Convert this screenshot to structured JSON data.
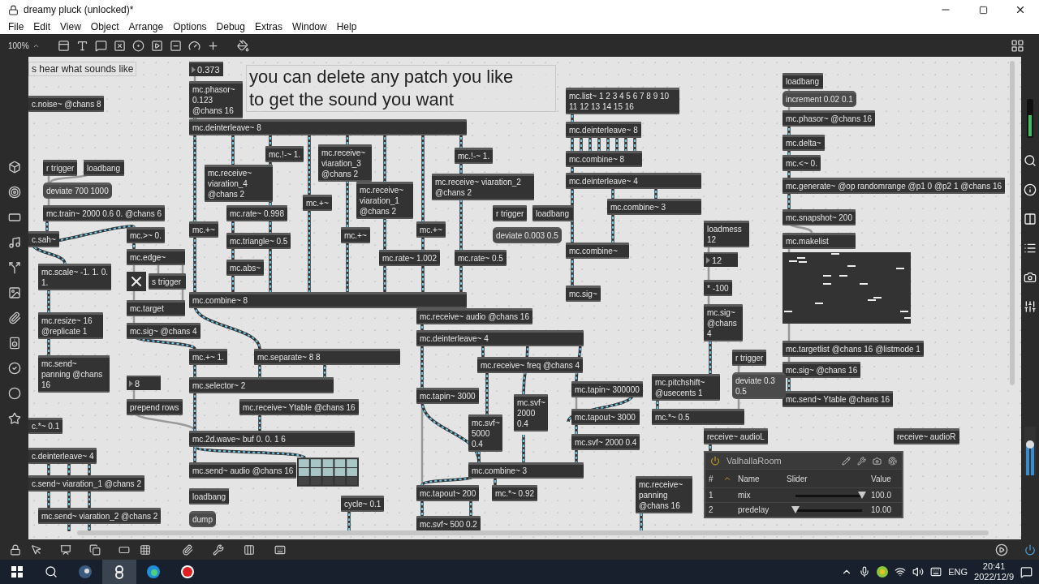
{
  "window": {
    "title": "dreamy pluck (unlocked)*"
  },
  "menu": [
    "File",
    "Edit",
    "View",
    "Object",
    "Arrange",
    "Options",
    "Debug",
    "Extras",
    "Window",
    "Help"
  ],
  "toolbar": {
    "zoom": "100%"
  },
  "patch": {
    "nodes": [
      {
        "kind": "comment",
        "text": "s hear what sounds like"
      },
      {
        "kind": "number",
        "text": "0.373"
      },
      {
        "kind": "object",
        "text": "mc.phasor~ 0.123 @chans 16"
      },
      {
        "kind": "object",
        "text": "c.noise~ @chans 8"
      },
      {
        "kind": "heading",
        "text": "you can delete any patch you like to get  the sound you want"
      },
      {
        "kind": "object",
        "text": "mc.deinterleave~ 8"
      },
      {
        "kind": "object",
        "text": "mc.!-~ 1."
      },
      {
        "kind": "object",
        "text": "mc.receive~ viaration_3 @chans 2"
      },
      {
        "kind": "object",
        "text": "mc.!-~ 1."
      },
      {
        "kind": "object",
        "text": "mc.list~ 1 2 3 4 5 6 7 8 9 10 11 12 13 14 15 16"
      },
      {
        "kind": "object",
        "text": "mc.deinterleave~ 8"
      },
      {
        "kind": "object",
        "text": "mc.combine~ 8"
      },
      {
        "kind": "object",
        "text": "mc.deinterleave~ 4"
      },
      {
        "kind": "object",
        "text": "mc.combine~ 3"
      },
      {
        "kind": "object",
        "text": "mc.combine~"
      },
      {
        "kind": "object",
        "text": "mc.sig~"
      },
      {
        "kind": "object",
        "text": "r trigger"
      },
      {
        "kind": "object",
        "text": "loadbang"
      },
      {
        "kind": "message",
        "text": "deviate 700 1000"
      },
      {
        "kind": "object",
        "text": "mc.receive~ viaration_4 @chans 2"
      },
      {
        "kind": "object",
        "text": "mc.+~"
      },
      {
        "kind": "object",
        "text": "mc.receive~ viaration_1 @chans 2"
      },
      {
        "kind": "object",
        "text": "mc.receive~ viaration_2 @chans 2"
      },
      {
        "kind": "object",
        "text": "mc.train~ 2000 0.6 0. @chans 6"
      },
      {
        "kind": "object",
        "text": "mc.rate~ 0.998"
      },
      {
        "kind": "object",
        "text": "mc.+~"
      },
      {
        "kind": "object",
        "text": "mc.+~"
      },
      {
        "kind": "object",
        "text": "mc.+~"
      },
      {
        "kind": "object",
        "text": "r trigger"
      },
      {
        "kind": "object",
        "text": "loadbang"
      },
      {
        "kind": "message",
        "text": "deviate 0.003 0.5"
      },
      {
        "kind": "object",
        "text": "c.sah~"
      },
      {
        "kind": "object",
        "text": "mc.>~ 0."
      },
      {
        "kind": "object",
        "text": "mc.triangle~ 0.5"
      },
      {
        "kind": "object",
        "text": "mc.scale~ -1. 1. 0. 1."
      },
      {
        "kind": "object",
        "text": "mc.edge~"
      },
      {
        "kind": "object",
        "text": "mc.abs~"
      },
      {
        "kind": "object",
        "text": "mc.rate~ 1.002"
      },
      {
        "kind": "object",
        "text": "mc.rate~ 0.5"
      },
      {
        "kind": "toggle",
        "checked": true
      },
      {
        "kind": "object",
        "text": "s trigger"
      },
      {
        "kind": "object",
        "text": "mc.combine~ 8"
      },
      {
        "kind": "object",
        "text": "mc.target"
      },
      {
        "kind": "object",
        "text": "mc.resize~ 16 @replicate 1"
      },
      {
        "kind": "object",
        "text": "mc.sig~ @chans 4"
      },
      {
        "kind": "object",
        "text": "mc.receive~ audio @chans 16"
      },
      {
        "kind": "object",
        "text": "mc.deinterleave~ 4"
      },
      {
        "kind": "object",
        "text": "loadmess 12"
      },
      {
        "kind": "number",
        "text": "12"
      },
      {
        "kind": "object",
        "text": "* -100"
      },
      {
        "kind": "object",
        "text": "mc.sig~ @chans 4"
      },
      {
        "kind": "object",
        "text": "loadbang"
      },
      {
        "kind": "message",
        "text": "increment 0.02 0.1"
      },
      {
        "kind": "object",
        "text": "mc.phasor~ @chans 16"
      },
      {
        "kind": "object",
        "text": "mc.delta~"
      },
      {
        "kind": "object",
        "text": "mc.<~ 0."
      },
      {
        "kind": "object",
        "text": "mc.generate~ @op randomrange @p1 0 @p2 1 @chans 16"
      },
      {
        "kind": "object",
        "text": "mc.snapshot~ 200"
      },
      {
        "kind": "object",
        "text": "mc.makelist"
      },
      {
        "kind": "multislider"
      },
      {
        "kind": "object",
        "text": "mc.targetlist @chans 16 @listmode 1"
      },
      {
        "kind": "object",
        "text": "mc.sig~ @chans 16"
      },
      {
        "kind": "object",
        "text": "mc.send~ Ytable @chans 16"
      },
      {
        "kind": "object",
        "text": "r trigger"
      },
      {
        "kind": "message",
        "text": "deviate 0.3 0.5"
      },
      {
        "kind": "object",
        "text": "mc.+~ 1."
      },
      {
        "kind": "object",
        "text": "mc.separate~ 8 8"
      },
      {
        "kind": "object",
        "text": "mc.send~ panning @chans 16"
      },
      {
        "kind": "number",
        "text": "8"
      },
      {
        "kind": "object",
        "text": "mc.selector~ 2"
      },
      {
        "kind": "object",
        "text": "mc.receive~ freq @chans 4"
      },
      {
        "kind": "object",
        "text": "mc.tapin~ 3000"
      },
      {
        "kind": "object",
        "text": "mc.tapin~ 300000"
      },
      {
        "kind": "object",
        "text": "mc.pitchshift~ @usecents 1"
      },
      {
        "kind": "object",
        "text": "mc.svf~ 2000 0.4"
      },
      {
        "kind": "object",
        "text": "mc.svf~ 5000 0.4"
      },
      {
        "kind": "object",
        "text": "prepend rows"
      },
      {
        "kind": "object",
        "text": "mc.receive~ Ytable @chans 16"
      },
      {
        "kind": "object",
        "text": "mc.tapout~ 3000"
      },
      {
        "kind": "object",
        "text": "mc.*~ 0.5"
      },
      {
        "kind": "object",
        "text": "c.*~ 0.1"
      },
      {
        "kind": "object",
        "text": "mc.2d.wave~ buf 0. 0. 1 6"
      },
      {
        "kind": "object",
        "text": "mc.svf~ 2000 0.4"
      },
      {
        "kind": "object",
        "text": "receive~ audioL"
      },
      {
        "kind": "object",
        "text": "receive~ audioR"
      },
      {
        "kind": "object",
        "text": "c.deinterleave~ 4"
      },
      {
        "kind": "object",
        "text": "mc.send~ audio @chans 16"
      },
      {
        "kind": "matrix"
      },
      {
        "kind": "object",
        "text": "mc.combine~ 3"
      },
      {
        "kind": "object",
        "text": "c.send~ viaration_1 @chans 2"
      },
      {
        "kind": "object",
        "text": "loadbang"
      },
      {
        "kind": "object",
        "text": "cycle~ 0.1"
      },
      {
        "kind": "object",
        "text": "mc.tapout~ 200"
      },
      {
        "kind": "object",
        "text": "mc.*~ 0.92"
      },
      {
        "kind": "object",
        "text": "mc.receive~ panning @chans 16"
      },
      {
        "kind": "object",
        "text": "mc.send~ viaration_2 @chans 2"
      },
      {
        "kind": "message",
        "text": "dump"
      },
      {
        "kind": "object",
        "text": "mc.svf~ 500 0.2"
      }
    ]
  },
  "plugin": {
    "title": "ValhallaRoom",
    "on": true,
    "columns": [
      "#",
      "Name",
      "Slider",
      "Value"
    ],
    "rows": [
      {
        "index": "1",
        "name": "mix",
        "level": 1.0,
        "value": "100.0"
      },
      {
        "index": "2",
        "name": "predelay",
        "level": 0.0,
        "value": "10.00"
      }
    ]
  },
  "taskbar": {
    "language": "ENG",
    "time": "20:41",
    "date": "2022/12/9"
  }
}
